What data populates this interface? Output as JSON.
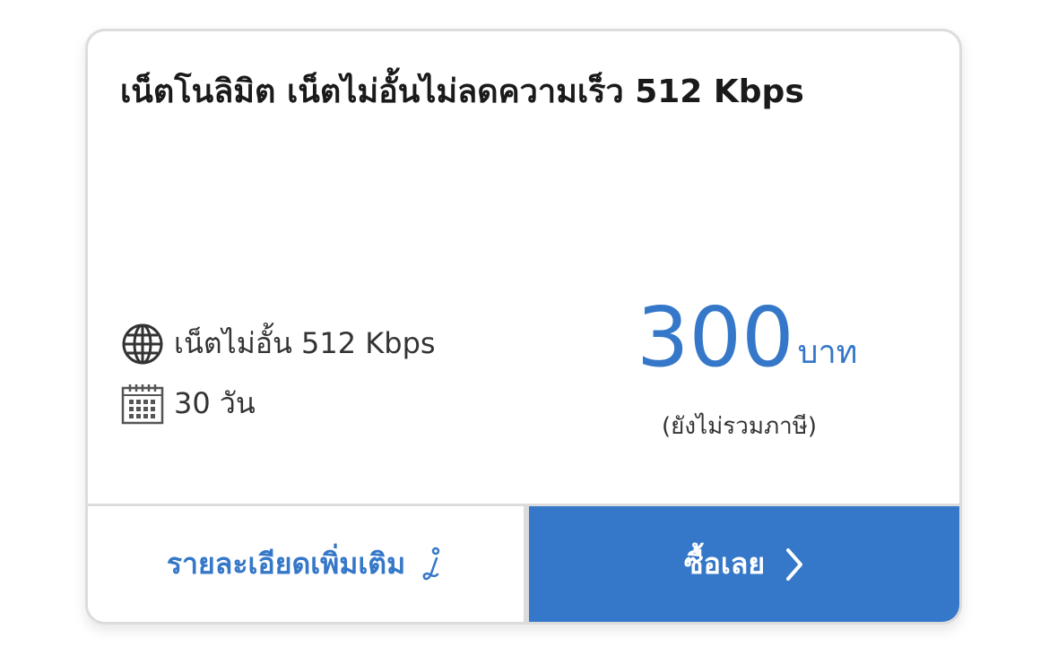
{
  "package": {
    "title": "เน็ตโนลิมิต เน็ตไม่อั้นไม่ลดความเร็ว 512 Kbps",
    "features": {
      "speed": {
        "icon": "globe-icon",
        "text": "เน็ตไม่อั้น 512 Kbps"
      },
      "duration": {
        "icon": "calendar-icon",
        "text": "30 วัน"
      }
    },
    "price": {
      "amount": "300",
      "unit": "บาท",
      "note": "(ยังไม่รวมภาษี)"
    }
  },
  "actions": {
    "details_label": "รายละเอียดเพิ่มเติม",
    "details_icon": "info-icon",
    "buy_label": "ซื้อเลย",
    "buy_icon": "chevron-right-icon"
  },
  "colors": {
    "accent": "#3577c8",
    "border": "#dcdcdc",
    "text": "#333333"
  }
}
